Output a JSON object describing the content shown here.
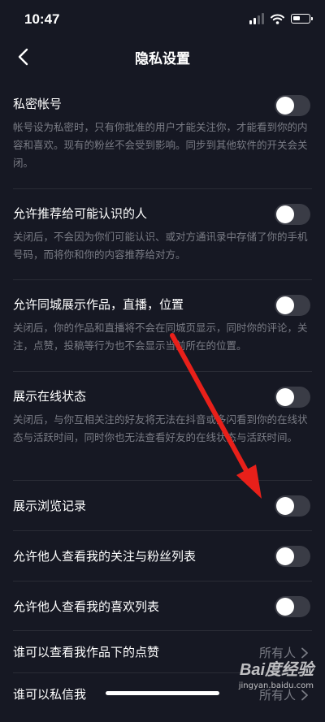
{
  "status_bar": {
    "time": "10:47"
  },
  "header": {
    "title": "隐私设置"
  },
  "settings": [
    {
      "label": "私密帐号",
      "desc": "帐号设为私密时，只有你批准的用户才能关注你，才能看到你的内容和喜欢。现有的粉丝不会受到影响。同步到其他软件的开关会关闭。",
      "enabled": false
    },
    {
      "label": "允许推荐给可能认识的人",
      "desc": "关闭后，不会因为你们可能认识、或对方通讯录中存储了你的手机号码，而将你和你的内容推荐给对方。",
      "enabled": false
    },
    {
      "label": "允许同城展示作品，直播，位置",
      "desc": "关闭后，你的作品和直播将不会在同城页显示，同时你的评论，关注，点赞，投稿等行为也不会显示当前所在的位置。",
      "enabled": false
    },
    {
      "label": "展示在线状态",
      "desc": "关闭后，与你互相关注的好友将无法在抖音或多闪看到你的在线状态与活跃时间，同时你也无法查看好友的在线状态与活跃时间。",
      "enabled": false
    },
    {
      "label": "展示浏览记录",
      "enabled": false
    },
    {
      "label": "允许他人查看我的关注与粉丝列表",
      "enabled": false
    },
    {
      "label": "允许他人查看我的喜欢列表",
      "enabled": false
    }
  ],
  "value_rows": [
    {
      "label": "谁可以查看我作品下的点赞",
      "value": "所有人"
    },
    {
      "label": "谁可以私信我",
      "value": "所有人"
    }
  ],
  "watermark": {
    "logo": "Bai度经验",
    "url": "jingyan.baidu.com"
  },
  "colors": {
    "background": "#161823",
    "annotation_arrow": "#e8201a",
    "toggle_off": "#3a3c46"
  }
}
